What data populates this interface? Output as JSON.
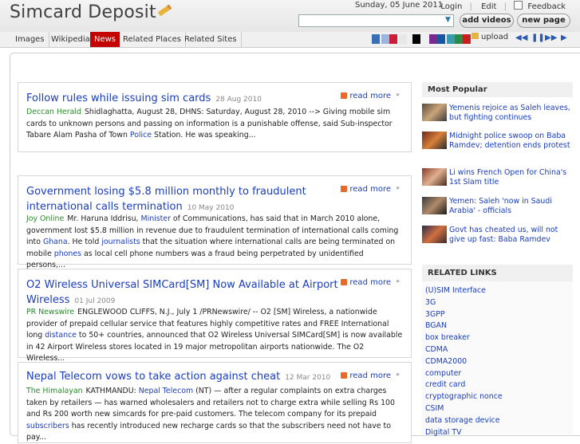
{
  "header": {
    "logo": "Simcard Deposit",
    "date": "Sunday, 05 June 2011",
    "login": "Login",
    "edit": "Edit",
    "feedback": "Feedback",
    "add_videos": "add videos",
    "new_page": "new page",
    "search_placeholder": ""
  },
  "nav": {
    "tabs": [
      "Images",
      "Wikipedia",
      "News",
      "Related Places",
      "Related Sites"
    ],
    "active": "News",
    "upload": "upload",
    "swatches": [
      "#3a6fb5",
      "#9ab6dd",
      "#c81e3a",
      "#e7e7e7",
      "#000000",
      "#7a2a8f",
      "#1a55a0",
      "#3a9ab0",
      "#2a8a4a",
      "#c81e1e",
      "#ffffff"
    ]
  },
  "articles": [
    {
      "title": "Follow rules while issuing sim cards",
      "date": "28 Aug 2010",
      "source": "Deccan Herald",
      "readmore": "read more",
      "text": "Shidlaghatta, August 28, DHNS: Saturday, August 28, 2010 --> Giving mobile sim cards to unknown persons and passing on information is a punishable offense, said Sub-inspector Tabare Alam Pasha of Town ",
      "kw1": "Police",
      "text2": " Station. He was speaking..."
    },
    {
      "title": "Government losing $5.8 million monthly to fraudulent international calls termination",
      "date": "10 May 2010",
      "source": "Joy Online",
      "readmore": "read more",
      "text": "Mr. Haruna Iddrisu, ",
      "kw1": "Minister",
      "text2": " of Communications, has said that in March 2010 alone, government lost $5.8 million in revenue due to fraudulent termination of international calls coming into ",
      "kw2": "Ghana",
      "text3": ". He told ",
      "kw3": "journalists",
      "text4": " that the situation where international calls are being terminated on mobile ",
      "kw4": "phones",
      "text5": " as local cell phone numbers was a fraud being perpetrated by unidentified persons,..."
    },
    {
      "title": "O2 Wireless Universal SIMCard[SM] Now Available at Airport Wireless",
      "date": "01 Jul 2009",
      "source": "PR Newswire",
      "readmore": "read more",
      "text": "ENGLEWOOD CLIFFS, N.J., July 1 /PRNewswire/ -- O2 [SM] Wireless, a nationwide provider of prepaid cellular service that features highly competitive rates and FREE International long ",
      "kw1": "distance",
      "text2": " to 50+ countries, announced that O2 Wireless Universal SIMCard[SM] is now available in 42 Airport Wireless stores located in 19 major metropolitan airports nationwide. The O2 Wireless..."
    },
    {
      "title": "Nepal Telecom vows to take action against cheat",
      "date": "12 Mar 2010",
      "source": "The Himalayan",
      "readmore": "read more",
      "text": "KATHMANDU: ",
      "kw1": "Nepal Telecom",
      "text2": " (NT) — after a regular complaints on extra charges taken by retailers — has warned wholesalers and retailers not to charge extra while selling Rs 100 and Rs 200 worth new simcards for pre-paid customers. The telecom company for its prepaid ",
      "kw2": "subscribers",
      "text3": " has recently introduced new recharge cards so that the subscribers need not have to pay..."
    }
  ],
  "sidebar": {
    "most_popular_title": "Most Popular",
    "popular": [
      "Yemenis rejoice as Saleh leaves, but fighting continues",
      "Midnight police swoop on Baba Ramdev; detention ends protest",
      "Li wins French Open for China's 1st Slam title",
      "Yemen: Saleh 'now in Saudi Arabia' - officials",
      "Govt has cheated us, will not give up fast: Baba Ramdev"
    ],
    "related_title": "RELATED LINKS",
    "related": [
      "(U)SIM Interface",
      "3G",
      "3GPP",
      "BGAN",
      "box breaker",
      "CDMA",
      "CDMA2000",
      "computer",
      "credit card",
      "cryptographic nonce",
      "CSIM",
      "data storage device",
      "Digital TV"
    ]
  }
}
